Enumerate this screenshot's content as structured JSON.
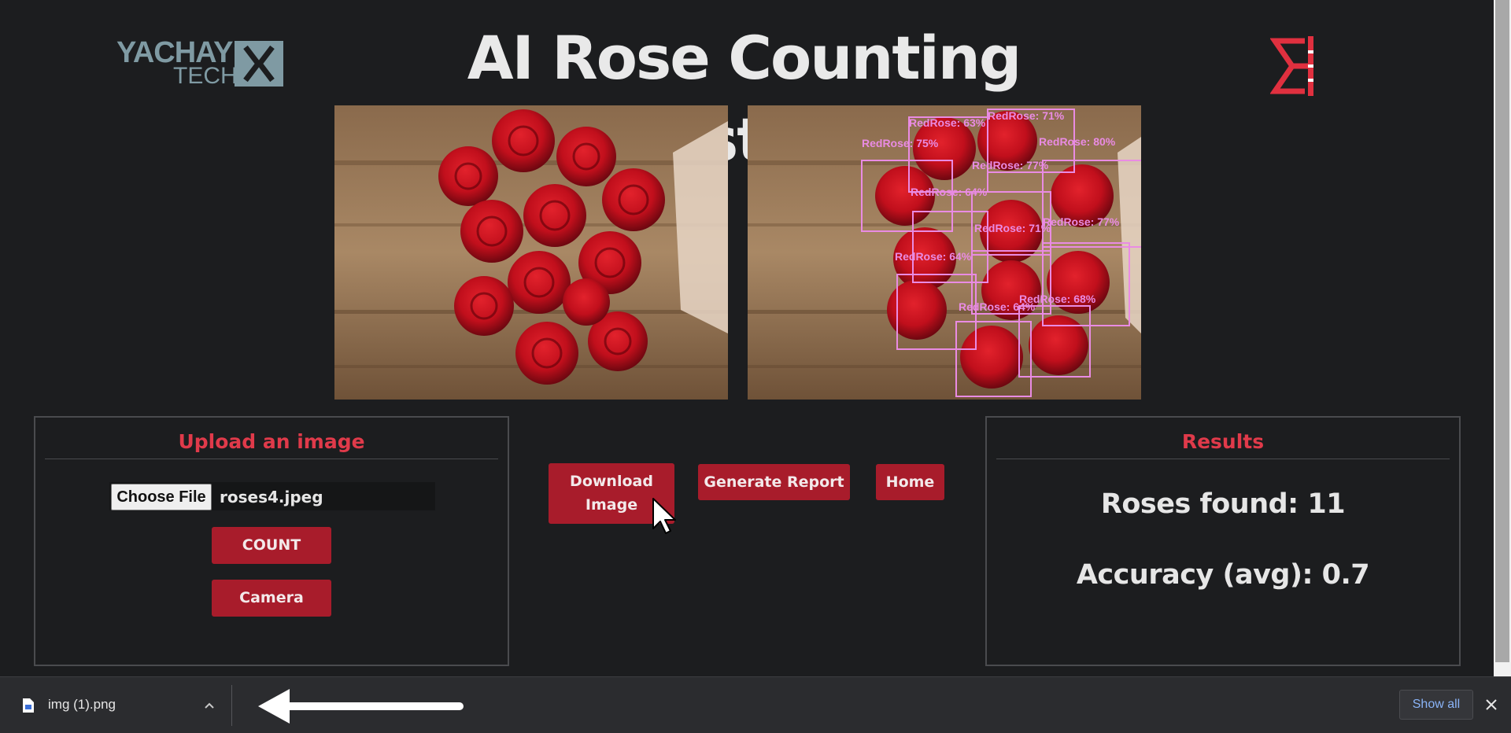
{
  "header": {
    "title": "AI Rose Counting System",
    "logo_left_line1": "YACHAY",
    "logo_left_line2": "TECH"
  },
  "images": {
    "original_alt": "Bouquet of red roses",
    "detected_alt": "Bouquet with detections",
    "detection_labels": [
      "RedRose: 63%",
      "RedRose: 71%",
      "RedRose: 75%",
      "RedRose: 80%",
      "RedRose: 77%",
      "RedRose: 64%",
      "RedRose: 71%",
      "RedRose: 77%",
      "RedRose: 64%",
      "RedRose: 68%",
      "RedRose: 64%"
    ],
    "detection_color": "#e98be3"
  },
  "upload": {
    "heading": "Upload an image",
    "choose_file_label": "Choose File",
    "file_name": "roses4.jpeg",
    "count_label": "COUNT",
    "camera_label": "Camera"
  },
  "actions": {
    "download_label_line1": "Download",
    "download_label_line2": "Image",
    "report_label": "Generate Report",
    "home_label": "Home"
  },
  "results": {
    "heading": "Results",
    "roses_found": "Roses found: 11",
    "accuracy": "Accuracy (avg): 0.7"
  },
  "download_bar": {
    "file_name": "img (1).png",
    "show_all_label": "Show all"
  },
  "colors": {
    "background": "#1c1d1f",
    "accent_red": "#a81c2b",
    "heading_red": "#e03a4a",
    "logo_blue_gray": "#7f9aa3",
    "link_blue": "#8ab4f8"
  }
}
